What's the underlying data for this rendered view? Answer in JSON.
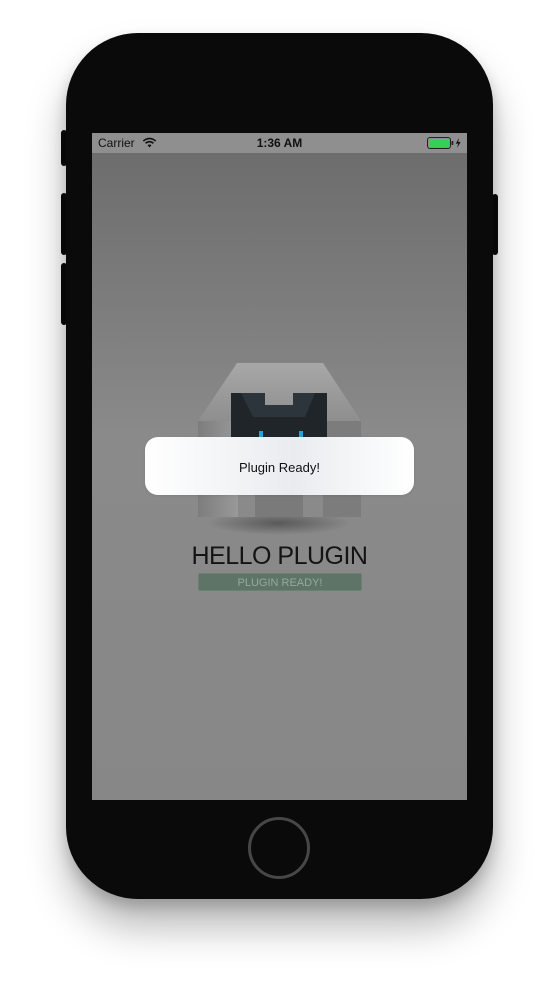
{
  "status_bar": {
    "carrier": "Carrier",
    "time": "1:36 AM",
    "icons": [
      "wifi-icon",
      "battery-icon",
      "charging-bolt-icon"
    ],
    "battery_color": "#34d058"
  },
  "app": {
    "logo": "plugin-logo-icon",
    "title": "HELLO PLUGIN",
    "status_button": "PLUGIN READY!"
  },
  "toast": {
    "message": "Plugin Ready!"
  },
  "device": {
    "home_button": "home-button",
    "frame_color": "#0a0a0a"
  }
}
